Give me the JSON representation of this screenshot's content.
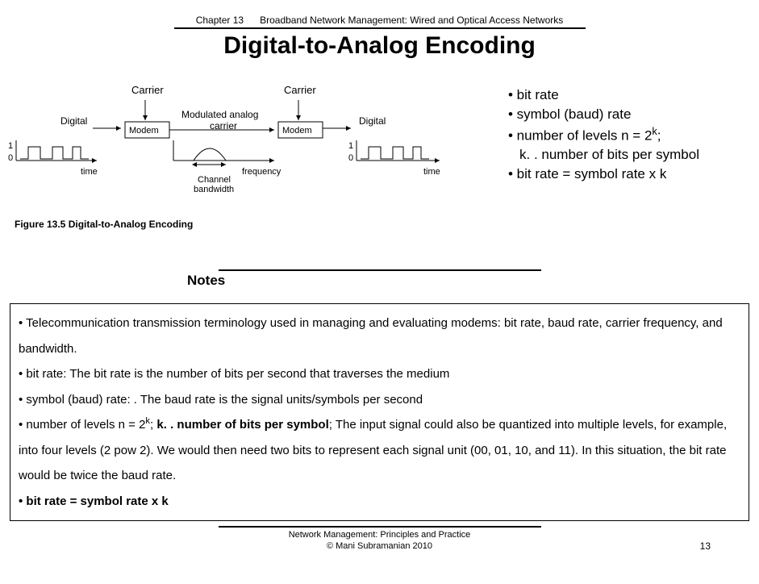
{
  "header": {
    "chapter": "Chapter 13",
    "subtitle": "Broadband Network Management: Wired and Optical Access Networks"
  },
  "title": "Digital-to-Analog Encoding",
  "diagram": {
    "carrier1": "Carrier",
    "carrier2": "Carrier",
    "digital1": "Digital",
    "digital2": "Digital",
    "modem1": "Modem",
    "modem2": "Modem",
    "modulated": "Modulated analog",
    "carrier_sub": "carrier",
    "time1": "time",
    "time2": "time",
    "frequency": "frequency",
    "channel": "Channel",
    "bandwidth": "bandwidth",
    "one": "1",
    "zero": "0",
    "caption": "Figure 13.5  Digital-to-Analog Encoding"
  },
  "bullets": {
    "b1": "• bit rate",
    "b2": "• symbol (baud) rate",
    "b3_pre": "• number of levels n = 2",
    "b3_sup": "k",
    "b3_post": ";",
    "b3_indent": "k. . number of bits per symbol",
    "b4": "• bit rate = symbol rate x k"
  },
  "notes_label": "Notes",
  "notes": {
    "n1": "• Telecommunication transmission terminology used in managing and evaluating modems: bit rate, baud rate, carrier frequency, and bandwidth.",
    "n2": "• bit rate: The bit rate is the number of bits per second that traverses the medium",
    "n3": "• symbol (baud) rate: . The baud rate is the signal units/symbols per second",
    "n4_pre": "• number of levels n = 2",
    "n4_sup": "k",
    "n4_mid": ";    ",
    "n4_bold": "k. . number of bits per symbol",
    "n4_post": "; The input signal could also be quantized into multiple levels, for example, into four levels (2 pow 2). We would then need two bits to represent each signal unit (00, 01, 10, and 11). In this situation, the bit rate would be twice the baud rate.",
    "n5": "• bit rate = symbol rate x k"
  },
  "footer": {
    "line1": "Network Management: Principles and Practice",
    "line2": "© Mani Subramanian 2010",
    "page": "13"
  }
}
